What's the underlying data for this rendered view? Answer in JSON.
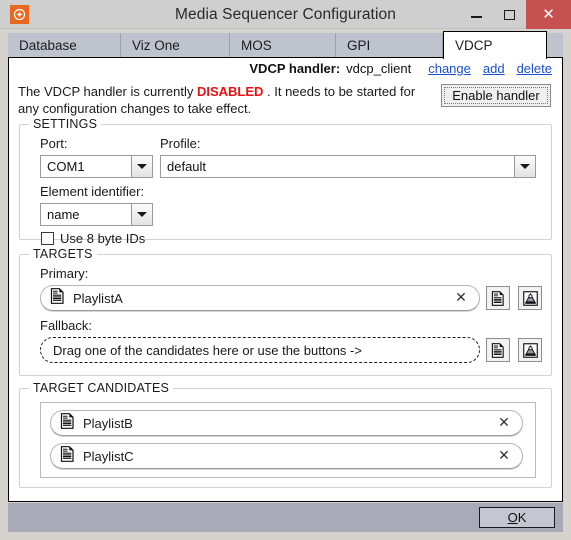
{
  "window": {
    "title": "Media Sequencer Configuration",
    "app_icon": "compass-icon",
    "minimize_label": "Minimize",
    "maximize_label": "Maximize",
    "close_label": "Close",
    "close_glyph": "✕"
  },
  "tabs": [
    {
      "label": "Database",
      "selected": false
    },
    {
      "label": "Viz One",
      "selected": false
    },
    {
      "label": "MOS",
      "selected": false
    },
    {
      "label": "GPI",
      "selected": false
    },
    {
      "label": "VDCP",
      "selected": true
    }
  ],
  "handler": {
    "label": "VDCP handler:",
    "value": "vdcp_client",
    "links": [
      {
        "label": "change"
      },
      {
        "label": "add"
      },
      {
        "label": "delete"
      }
    ]
  },
  "status": {
    "prefix": "The VDCP handler is currently ",
    "state": "DISABLED",
    "state_color": "#ee1111",
    "suffix": " . It needs to be started for any configuration  changes to take effect.",
    "enable_button": "Enable handler"
  },
  "settings": {
    "legend": "SETTINGS",
    "port_label": "Port:",
    "port_value": "COM1",
    "profile_label": "Profile:",
    "profile_value": "default",
    "element_identifier_label": "Element identifier:",
    "element_identifier_value": "name",
    "use_8_byte_ids_label": "Use 8 byte IDs",
    "use_8_byte_ids_checked": false
  },
  "targets": {
    "legend": "TARGETS",
    "primary_label": "Primary:",
    "primary_value": "PlaylistA",
    "primary_icon": "document-icon",
    "primary_clear_glyph": "✕",
    "fallback_label": "Fallback:",
    "fallback_placeholder": "Drag one of the candidates here or use the buttons ->",
    "row_buttons": [
      {
        "name": "add-playlist-button",
        "icon": "document-icon"
      },
      {
        "name": "add-group-button",
        "icon": "group-icon"
      }
    ]
  },
  "target_candidates": {
    "legend": "TARGET CANDIDATES",
    "items": [
      {
        "label": "PlaylistB",
        "icon": "document-icon",
        "clear_glyph": "✕"
      },
      {
        "label": "PlaylistC",
        "icon": "document-icon",
        "clear_glyph": "✕"
      }
    ]
  },
  "footer": {
    "ok_mnemonic": "O",
    "ok_rest": "K"
  }
}
